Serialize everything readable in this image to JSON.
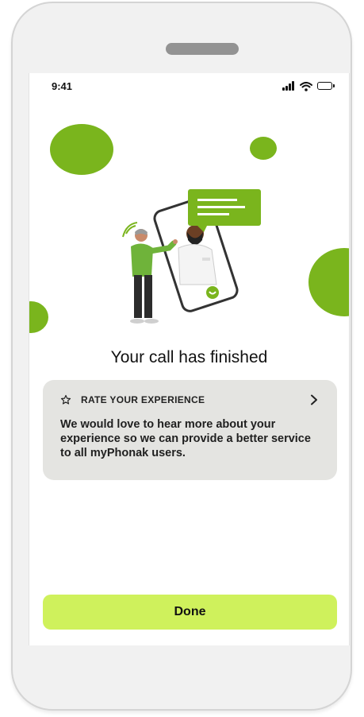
{
  "status_bar": {
    "time": "9:41",
    "icons": [
      "signal-icon",
      "wifi-icon",
      "battery-icon"
    ]
  },
  "illustration": {
    "icons": [
      "person-with-hearing-aid-illustration",
      "phone-video-call-illustration",
      "chat-bubble-icon",
      "call-icon"
    ]
  },
  "main": {
    "title": "Your call has finished"
  },
  "rating_card": {
    "icon": "star-icon",
    "title": "RATE YOUR EXPERIENCE",
    "chevron": ">",
    "text": "We would love to hear more about your experience so we can provide a better service to all myPhonak users."
  },
  "actions": {
    "done_label": "Done"
  },
  "colors": {
    "accent_green": "#7ab51d",
    "button_bg": "#cff15c",
    "card_bg": "#e4e4e1"
  }
}
